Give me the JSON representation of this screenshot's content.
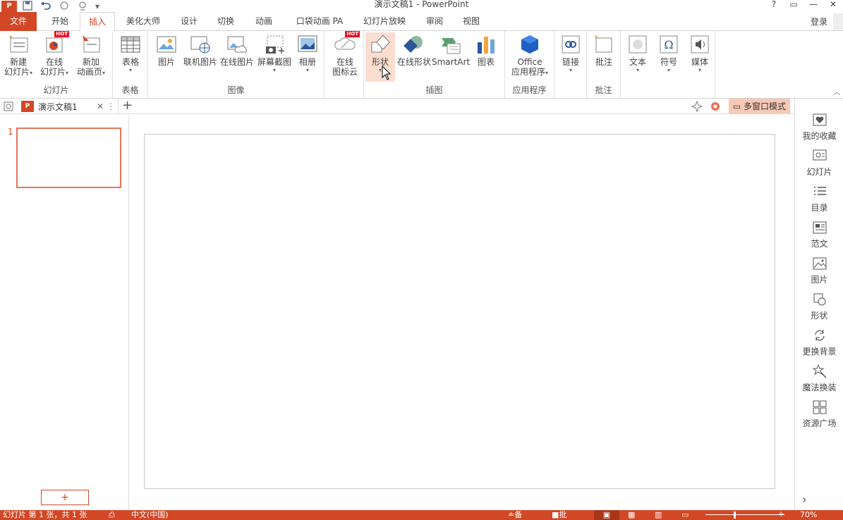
{
  "window": {
    "title": "演示文稿1 - PowerPoint",
    "app_icon_label": "P",
    "qat": [
      "save-icon",
      "undo-icon",
      "redo-icon",
      "preview-icon",
      "customize-icon"
    ],
    "controls": {
      "help": "?",
      "restore_ribbon": "▭",
      "minimize": "—",
      "close": "✕"
    }
  },
  "tabs": [
    {
      "label": "文件"
    },
    {
      "label": "开始"
    },
    {
      "label": "插入"
    },
    {
      "label": "美化大师"
    },
    {
      "label": "设计"
    },
    {
      "label": "切换"
    },
    {
      "label": "动画"
    },
    {
      "label": "口袋动画 PA"
    },
    {
      "label": "幻灯片放映"
    },
    {
      "label": "审阅"
    },
    {
      "label": "视图"
    }
  ],
  "login_label": "登录",
  "ribbon": {
    "groups": {
      "slides": "幻灯片",
      "table": "表格",
      "images": "图像",
      "illustrations": "插图",
      "apps": "应用程序",
      "comments": "批注"
    },
    "buttons": {
      "new_slide": [
        "新建",
        "幻灯片"
      ],
      "online_slide": [
        "在线",
        "幻灯片"
      ],
      "new_anim_page": [
        "新加",
        "动画页"
      ],
      "table": "表格",
      "picture": "图片",
      "online_picture_lianji": "联机图片",
      "online_picture": "在线图片",
      "screenshot": "屏幕截图",
      "album": "相册",
      "online_icons": [
        "在线",
        "图标云"
      ],
      "shapes": "形状",
      "online_shapes": "在线形状",
      "smartart": "SmartArt",
      "chart": "图表",
      "office_apps": [
        "Office",
        "应用程序"
      ],
      "link": "链接",
      "comment": "批注",
      "text": "文本",
      "symbol": "符号",
      "media": "媒体"
    },
    "hot_badge": "HOT"
  },
  "docbar": {
    "doc_name": "演示文稿1",
    "multiwindow_label": "多窗口模式",
    "add_tab": "+"
  },
  "slides_panel": {
    "slide_number": "1",
    "add_label": "+"
  },
  "rightbar": [
    {
      "label": "我的收藏",
      "icon": "heart-icon"
    },
    {
      "label": "幻灯片",
      "icon": "slides-icon"
    },
    {
      "label": "目录",
      "icon": "list-icon"
    },
    {
      "label": "范文",
      "icon": "template-icon"
    },
    {
      "label": "图片",
      "icon": "image-icon"
    },
    {
      "label": "形状",
      "icon": "shape-icon"
    },
    {
      "label": "更换背景",
      "icon": "refresh-icon"
    },
    {
      "label": "魔法换装",
      "icon": "magic-icon"
    },
    {
      "label": "资源广场",
      "icon": "grid-icon"
    }
  ],
  "status": {
    "slide_info": "幻灯片 第 1 张，共 1 张",
    "language": "中文(中国)",
    "notes": "备注",
    "comments": "批注",
    "zoom": "70%"
  }
}
